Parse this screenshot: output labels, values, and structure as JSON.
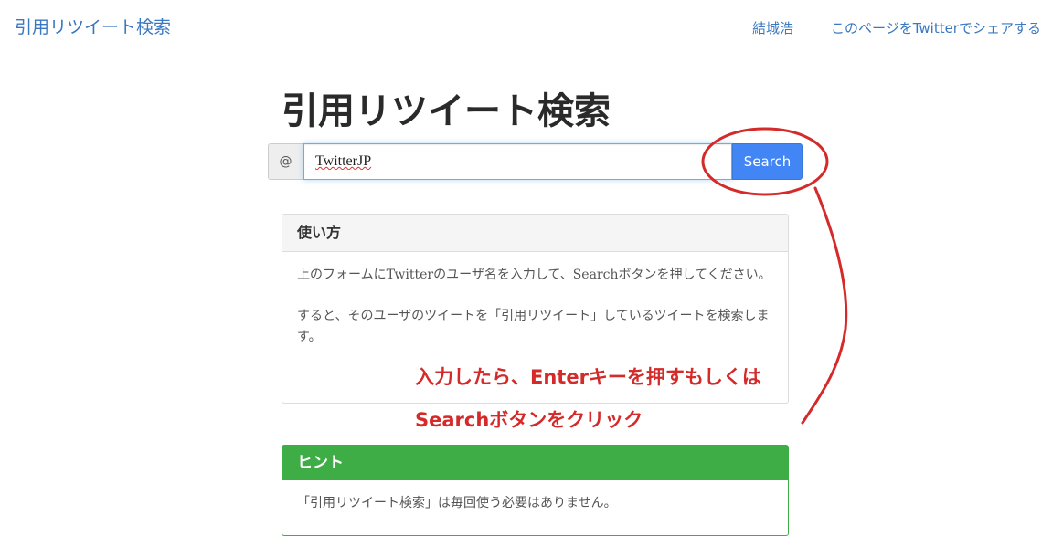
{
  "navbar": {
    "brand": "引用リツイート検索",
    "links": [
      {
        "label": "結城浩"
      },
      {
        "label": "このページをTwitterでシェアする"
      }
    ]
  },
  "main": {
    "title": "引用リツイート検索",
    "search": {
      "prefix": "@",
      "value": "TwitterJP",
      "button_label": "Search"
    },
    "howto": {
      "heading": "使い方",
      "paragraphs": [
        "上のフォームにTwitterのユーザ名を入力して、Searchボタンを押してください。",
        "すると、そのユーザのツイートを「引用リツイート」しているツイートを検索します。"
      ]
    },
    "hint": {
      "heading": "ヒント",
      "text": "「引用リツイート検索」は毎回使う必要はありません。"
    }
  },
  "annotation": {
    "line1": "入力したら、Enterキーを押すもしくは",
    "line2": "Searchボタンをクリック",
    "color": "#d42a2a"
  },
  "colors": {
    "link": "#3a78c2",
    "button": "#4285f4",
    "hint": "#3fad46"
  }
}
